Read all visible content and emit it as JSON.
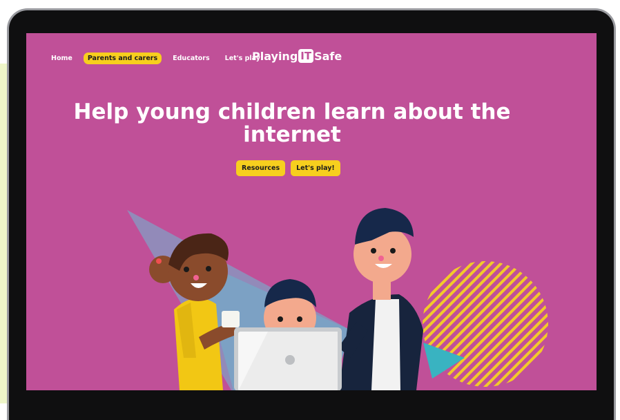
{
  "nav": {
    "items": [
      {
        "label": "Home",
        "active": false
      },
      {
        "label": "Parents and carers",
        "active": true
      },
      {
        "label": "Educators",
        "active": false
      },
      {
        "label": "Let's play!",
        "active": false
      }
    ]
  },
  "logo": {
    "prefix": "Playing",
    "box": "IT",
    "suffix": "Safe"
  },
  "hero": {
    "headline": "Help young children learn about the internet",
    "buttons": [
      "Resources",
      "Let's play!"
    ]
  },
  "colors": {
    "background": "#c05098",
    "accent": "#f7cf1e",
    "frame": "#0f0f10"
  }
}
